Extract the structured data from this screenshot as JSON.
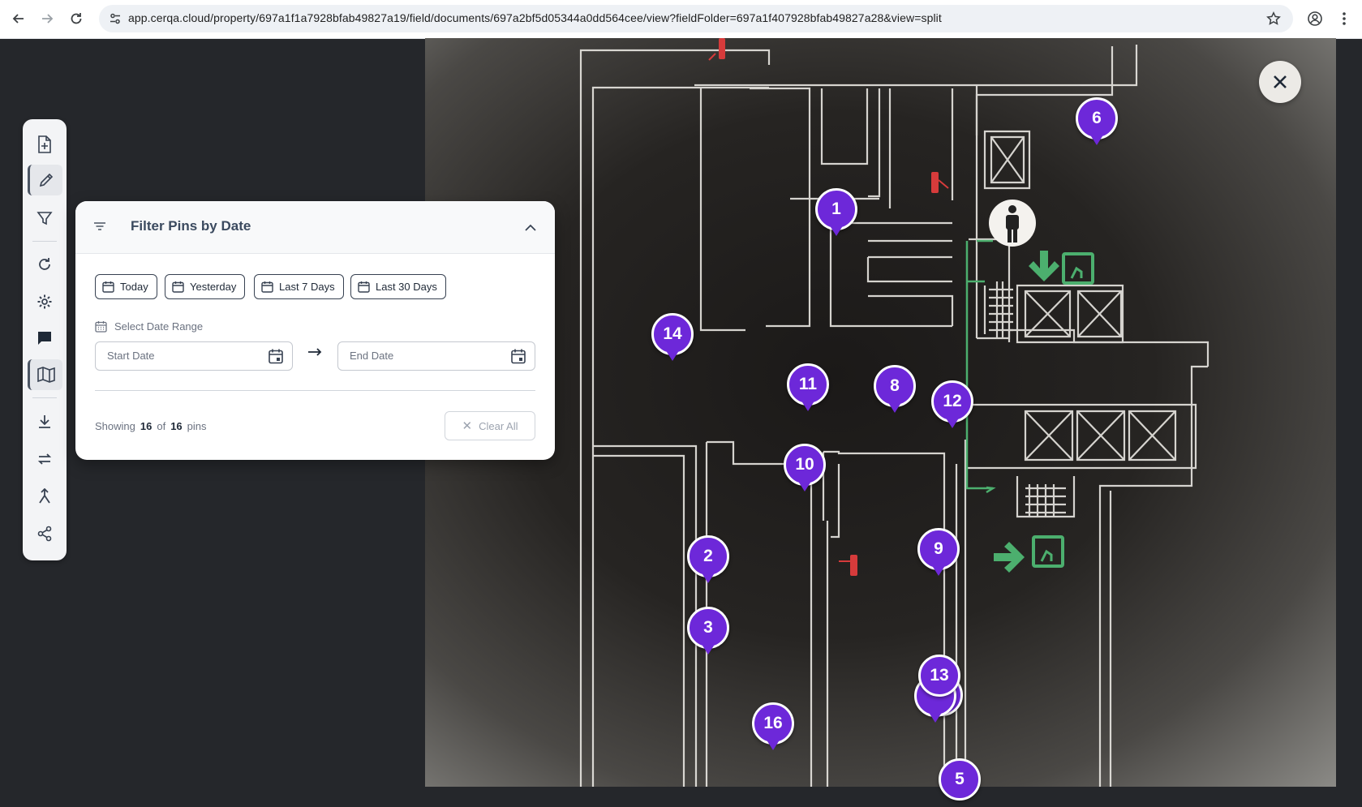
{
  "browser": {
    "url": "app.cerqa.cloud/property/697a1f1a7928bfab49827a19/field/documents/697a2bf5d05344a0dd564cee/view?fieldFolder=697a1f407928bfab49827a28&view=split"
  },
  "filter_panel": {
    "title": "Filter Pins by Date",
    "quick_ranges": [
      "Today",
      "Yesterday",
      "Last 7 Days",
      "Last 30 Days"
    ],
    "range_label": "Select Date Range",
    "start_placeholder": "Start Date",
    "end_placeholder": "End Date",
    "showing_prefix": "Showing",
    "showing_count": "16",
    "showing_of": "of",
    "showing_total": "16",
    "showing_suffix": "pins",
    "clear_label": "Clear All"
  },
  "pins": [
    {
      "label": "1"
    },
    {
      "label": "6"
    },
    {
      "label": "14"
    },
    {
      "label": "11"
    },
    {
      "label": "8"
    },
    {
      "label": "12"
    },
    {
      "label": "10"
    },
    {
      "label": "2"
    },
    {
      "label": "9"
    },
    {
      "label": "3"
    },
    {
      "label": "13"
    },
    {
      "label": "16"
    },
    {
      "label": "5"
    }
  ],
  "colors": {
    "pin": "#6d28d9",
    "exit_sign": "#4caf6e",
    "extinguisher": "#d63b3b"
  },
  "toolbar": {
    "icons": [
      "add-document-icon",
      "pencil-icon",
      "filter-icon",
      "refresh-icon",
      "gear-icon",
      "chat-icon",
      "map-icon",
      "download-icon",
      "swap-icon",
      "merge-icon",
      "share-icon"
    ]
  }
}
